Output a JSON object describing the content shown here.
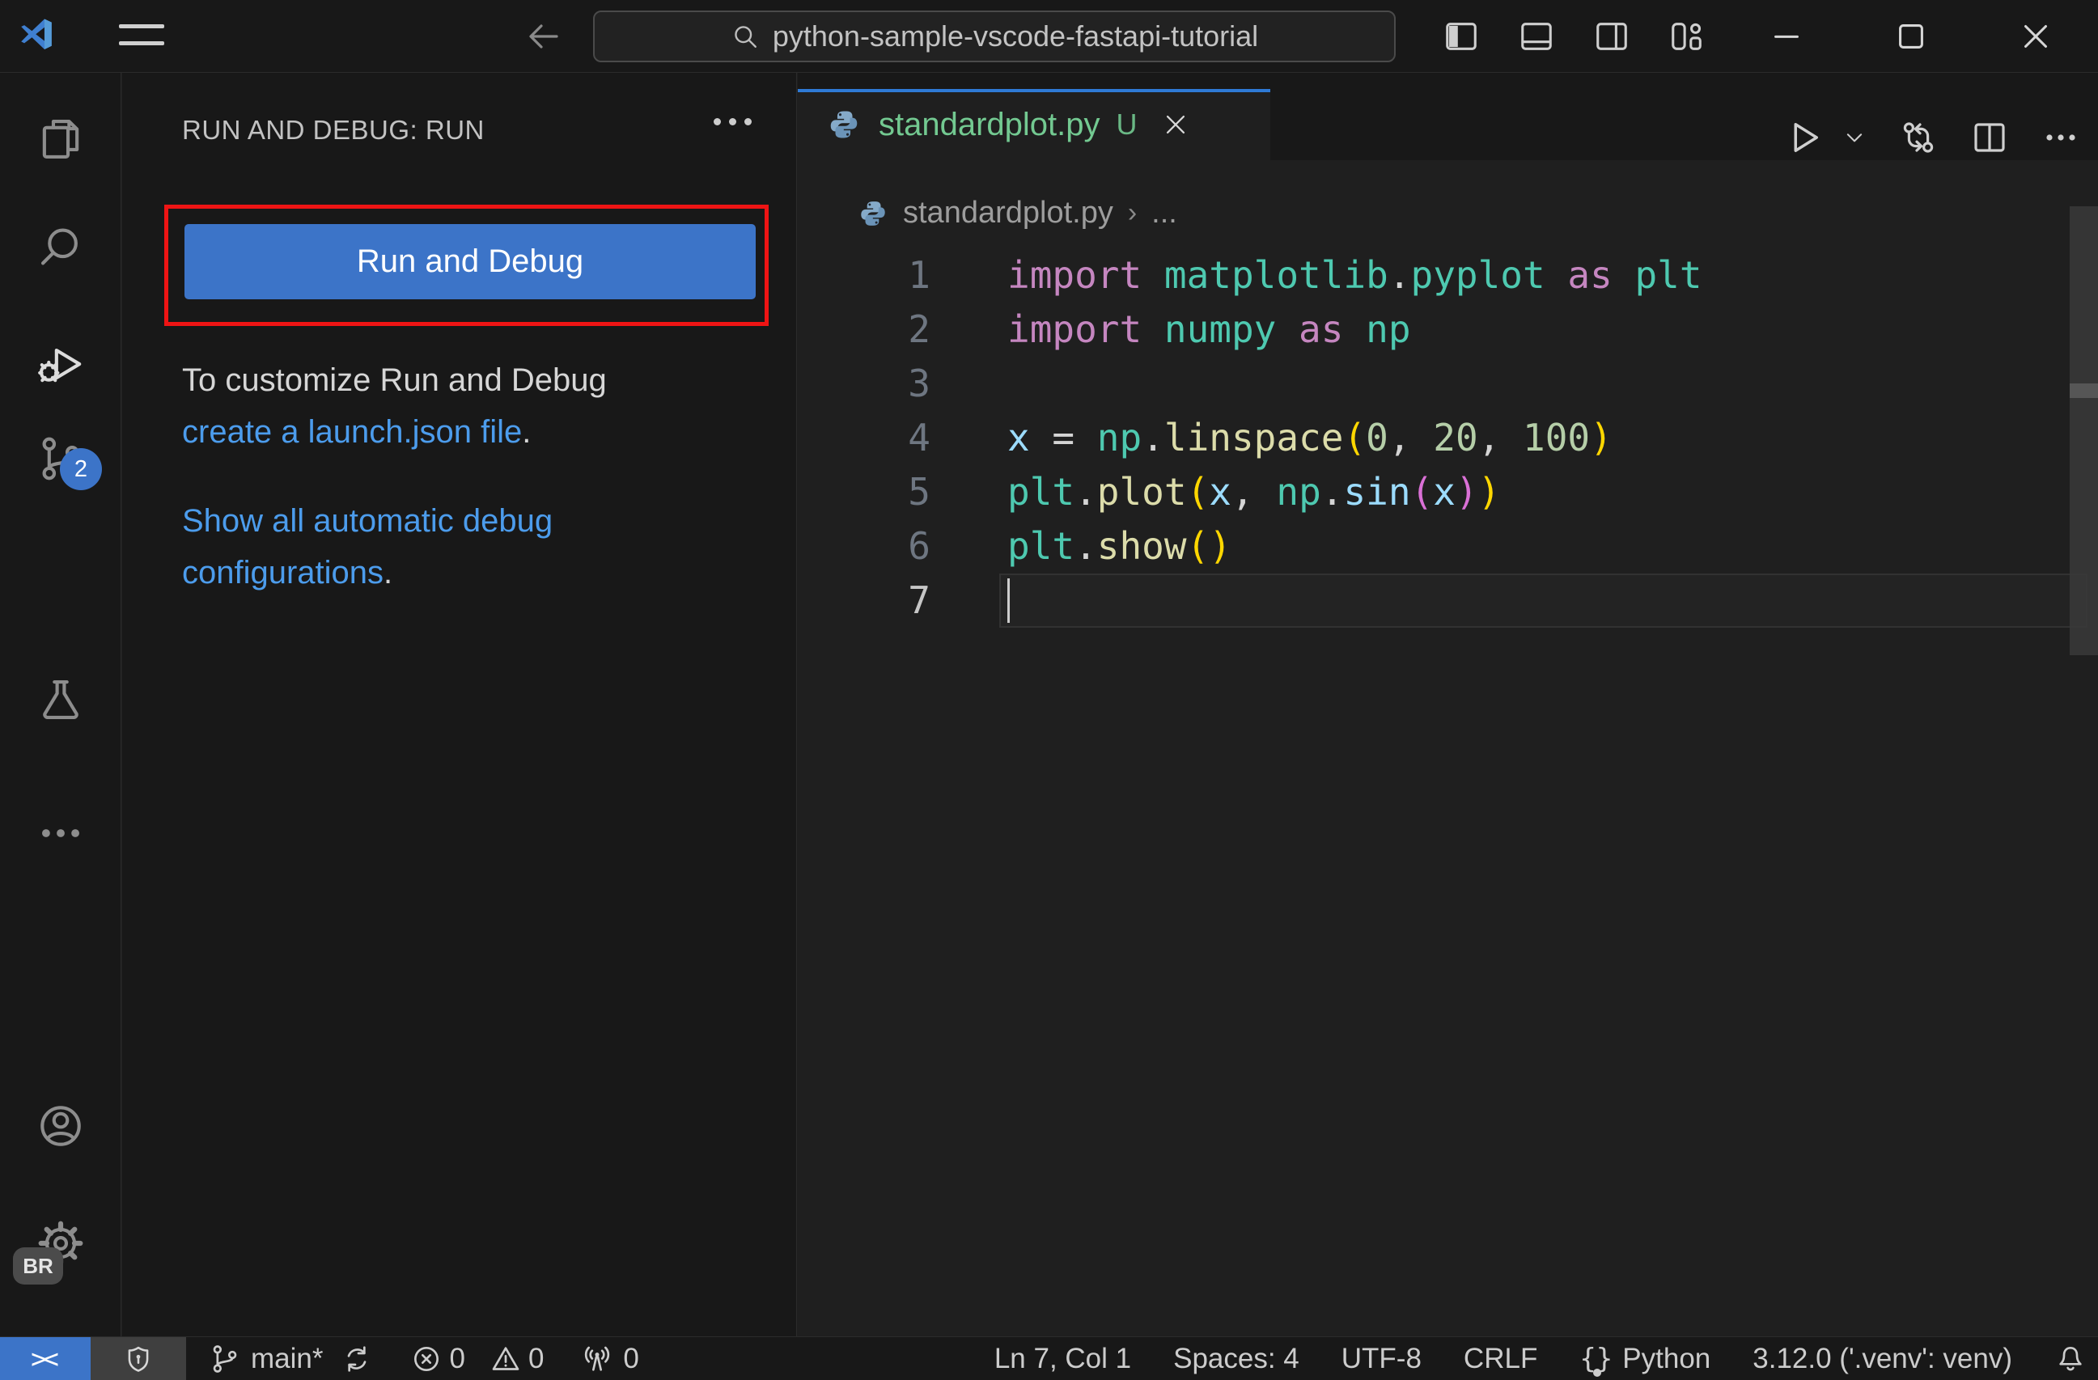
{
  "title_bar": {
    "search_value": "python-sample-vscode-fastapi-tutorial"
  },
  "activity_bar": {
    "scm_badge": "2",
    "profile_badge": "BR"
  },
  "sidebar": {
    "header": "RUN AND DEBUG: RUN",
    "run_button_label": "Run and Debug",
    "hint_text": "To customize Run and Debug",
    "hint_link": "create a launch.json file",
    "hint_suffix": ".",
    "link2": "Show all automatic debug configurations",
    "link2_suffix": "."
  },
  "editor": {
    "tab": {
      "label": "standardplot.py",
      "git_badge": "U"
    },
    "breadcrumb": {
      "file": "standardplot.py",
      "more": "..."
    },
    "code": {
      "lines": [
        {
          "n": "1",
          "tokens": [
            [
              "kw",
              "import "
            ],
            [
              "mod",
              "matplotlib"
            ],
            [
              "op",
              "."
            ],
            [
              "mod",
              "pyplot"
            ],
            [
              "kw",
              " as "
            ],
            [
              "mod",
              "plt"
            ]
          ]
        },
        {
          "n": "2",
          "tokens": [
            [
              "kw",
              "import "
            ],
            [
              "mod",
              "numpy"
            ],
            [
              "kw",
              " as "
            ],
            [
              "mod",
              "np"
            ]
          ]
        },
        {
          "n": "3",
          "tokens": []
        },
        {
          "n": "4",
          "tokens": [
            [
              "var",
              "x"
            ],
            [
              "op",
              " = "
            ],
            [
              "mod",
              "np"
            ],
            [
              "op",
              "."
            ],
            [
              "fn",
              "linspace"
            ],
            [
              "br1",
              "("
            ],
            [
              "num",
              "0"
            ],
            [
              "op",
              ", "
            ],
            [
              "num",
              "20"
            ],
            [
              "op",
              ", "
            ],
            [
              "num",
              "100"
            ],
            [
              "br1",
              ")"
            ]
          ]
        },
        {
          "n": "5",
          "tokens": [
            [
              "mod",
              "plt"
            ],
            [
              "op",
              "."
            ],
            [
              "fn",
              "plot"
            ],
            [
              "br1",
              "("
            ],
            [
              "var",
              "x"
            ],
            [
              "op",
              ", "
            ],
            [
              "mod",
              "np"
            ],
            [
              "op",
              "."
            ],
            [
              "var",
              "sin"
            ],
            [
              "br2",
              "("
            ],
            [
              "var",
              "x"
            ],
            [
              "br2",
              ")"
            ],
            [
              "br1",
              ")"
            ]
          ]
        },
        {
          "n": "6",
          "tokens": [
            [
              "mod",
              "plt"
            ],
            [
              "op",
              "."
            ],
            [
              "fn",
              "show"
            ],
            [
              "br1",
              "("
            ],
            [
              "br1",
              ")"
            ]
          ]
        },
        {
          "n": "7",
          "tokens": [],
          "current": true
        }
      ]
    }
  },
  "status_bar": {
    "branch": "main*",
    "errors": "0",
    "warnings": "0",
    "ports": "0",
    "line_col": "Ln 7, Col 1",
    "spaces": "Spaces: 4",
    "encoding": "UTF-8",
    "eol": "CRLF",
    "language": "Python",
    "interpreter": "3.12.0 ('.venv': venv)"
  },
  "colors": {
    "accent_blue": "#3c74c8",
    "tab_active_border": "#2e7ad6",
    "annotation_red": "#ee1414",
    "link_blue": "#4c9cec",
    "git_untracked_green": "#73C991",
    "keyword_purple": "#C586C0",
    "type_teal": "#4EC9B0",
    "function_yellow": "#DCDCAA",
    "variable_light_blue": "#9CDCFE",
    "number_green": "#B5CEA8",
    "bracket_gold": "#FFD700",
    "bracket_orchid": "#DA70D6"
  }
}
